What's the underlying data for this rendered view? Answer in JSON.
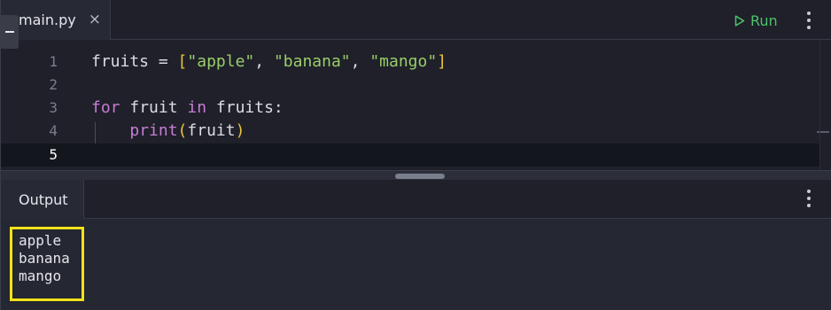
{
  "editor": {
    "tab_label": "main.py",
    "tab_close": "×",
    "run_label": "Run",
    "lines": [
      {
        "num": "1"
      },
      {
        "num": "2"
      },
      {
        "num": "3"
      },
      {
        "num": "4"
      },
      {
        "num": "5"
      }
    ],
    "tokens": {
      "l1_fruits": "fruits",
      "l1_eq": " = ",
      "l1_lb": "[",
      "l1_s1": "\"apple\"",
      "l1_c1": ", ",
      "l1_s2": "\"banana\"",
      "l1_c2": ", ",
      "l1_s3": "\"mango\"",
      "l1_rb": "]",
      "l3_for": "for",
      "l3_fruit": " fruit ",
      "l3_in": "in",
      "l3_fruits": " fruits:",
      "l4_indent": "    ",
      "l4_print": "print",
      "l4_lp": "(",
      "l4_arg": "fruit",
      "l4_rp": ")"
    }
  },
  "output": {
    "tab_label": "Output",
    "lines": [
      "apple",
      "banana",
      "mango"
    ]
  },
  "colors": {
    "run_green": "#4cc36b",
    "highlight_yellow": "#f2e21a",
    "keyword_purple": "#c97bd9",
    "string_green": "#9acd6a",
    "bracket_yellow": "#e8c43c"
  },
  "icons": {
    "run": "play-outline-icon",
    "menu": "kebab-menu-icon",
    "collapse": "minus-icon",
    "close": "close-icon"
  }
}
